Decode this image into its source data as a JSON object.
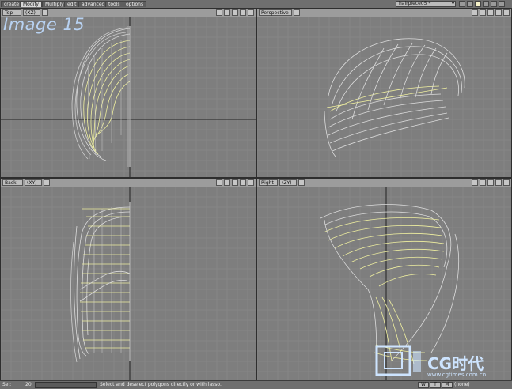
{
  "menu": {
    "tabs": [
      {
        "label": "create"
      },
      {
        "label": "Modify"
      },
      {
        "label": "Multiply"
      },
      {
        "label": "edit"
      },
      {
        "label": "advanced"
      },
      {
        "label": "tools"
      },
      {
        "label": "options"
      }
    ],
    "active_tab": "Modify",
    "object_selector": "hairpiece05 *"
  },
  "overlay_title": "Image 15",
  "viewports": {
    "top": {
      "label": "Top",
      "axis": "(XZ)"
    },
    "perspective": {
      "label": "Perspective"
    },
    "back": {
      "label": "Back",
      "axis": "(XY)"
    },
    "right": {
      "label": "Right",
      "axis": "(ZY)"
    }
  },
  "status": {
    "sel_label": "Sel:",
    "sel_count": "20",
    "message": "Select and deselect polygons directly or with lasso.",
    "buttons": [
      {
        "label": "W"
      },
      {
        "label": "T"
      },
      {
        "label": "M"
      }
    ],
    "layer": "(none)"
  },
  "watermark": {
    "text": "CG时代",
    "url": "www.cgtimes.com.cn"
  },
  "colors": {
    "grid": "#8c8c8c",
    "wire": "#dcdcdc",
    "selected": "#f0f0a0",
    "axis": "#222222",
    "watermark": "#cde4ff"
  }
}
